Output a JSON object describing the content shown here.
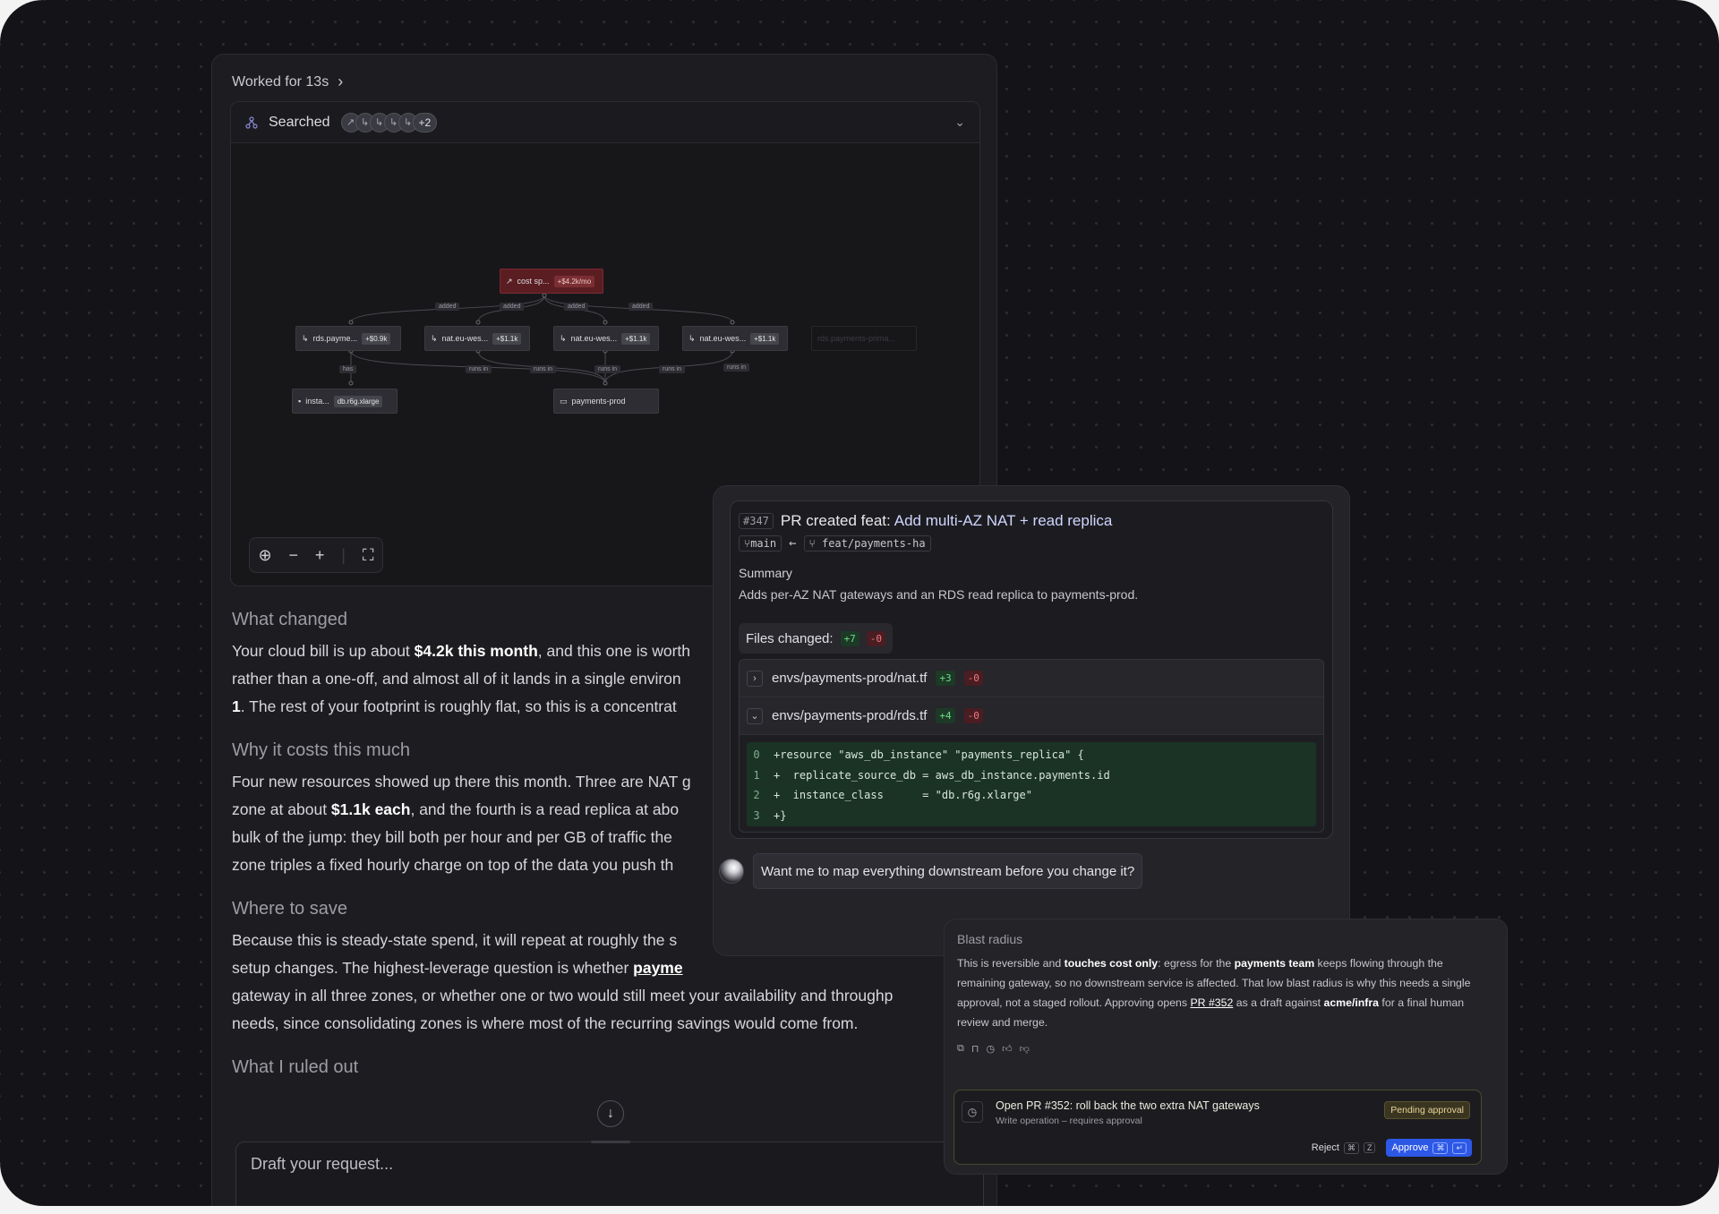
{
  "chat": {
    "worked_label": "Worked for 13s",
    "search_title": "Searched",
    "search_more": "+2",
    "graph": {
      "root": {
        "label": "cost sp...",
        "cost": "+$4.2k/mo"
      },
      "edge_added": "added",
      "edge_has": "has",
      "edge_runs_in": "runs in",
      "nodes": [
        {
          "label": "rds.payme...",
          "cost": "+$0.9k"
        },
        {
          "label": "nat.eu-wes...",
          "cost": "+$1.1k"
        },
        {
          "label": "nat.eu-wes...",
          "cost": "+$1.1k"
        },
        {
          "label": "nat.eu-wes...",
          "cost": "+$1.1k"
        },
        {
          "label": "rds.payments-prima..."
        }
      ],
      "instance": {
        "label": "insta...",
        "cost": "db.r6g.xlarge"
      },
      "env": {
        "label": "payments-prod"
      }
    },
    "sections": [
      {
        "heading": "What changed"
      },
      {
        "heading": "Why it costs this much"
      },
      {
        "heading": "Where to save"
      },
      {
        "heading": "What I ruled out"
      }
    ],
    "p1": {
      "a": "Your cloud bill is up about ",
      "b": "$4.2k this month",
      "c": ", and this one is worth",
      "d": "rather than a one-off, and almost all of it lands in a single environ",
      "e": "1",
      "f": ". The rest of your footprint is roughly flat, so this is a concentrat"
    },
    "p2": {
      "a": "Four new resources showed up there this month. Three are NAT g",
      "b": "zone at about ",
      "c": "$1.1k each",
      "d": ", and the fourth is a read replica at abo",
      "e": "bulk of the jump: they bill both per hour and per GB of traffic the",
      "f": "zone triples a fixed hourly charge on top of the data you push th"
    },
    "p3": {
      "a": "Because this is steady-state spend, it will repeat at roughly the s",
      "b": "setup changes. The highest-leverage question is whether ",
      "c": "payme",
      "d": "gateway in all three zones, or whether one or two would still meet your availability and throughp",
      "e": "needs, since consolidating zones is where most of the recurring savings would come from."
    },
    "draft_placeholder": "Draft your request..."
  },
  "pr": {
    "number": "#347",
    "title_prefix": "PR created feat: ",
    "title_main": "Add multi-AZ NAT + read replica",
    "base_branch": "main",
    "head_branch": "feat/payments-ha",
    "summary_label": "Summary",
    "summary_text": "Adds per-AZ NAT gateways and an RDS read replica to payments-prod.",
    "files_label": "Files changed:",
    "files_add": "+7",
    "files_del": "-0",
    "files": [
      {
        "name": "envs/payments-prod/nat.tf",
        "add": "+3",
        "del": "-0"
      },
      {
        "name": "envs/payments-prod/rds.tf",
        "add": "+4",
        "del": "-0"
      }
    ],
    "code": [
      {
        "n": "0",
        "t": "+resource \"aws_db_instance\" \"payments_replica\" {"
      },
      {
        "n": "1",
        "t": "+  replicate_source_db = aws_db_instance.payments.id"
      },
      {
        "n": "2",
        "t": "+  instance_class      = \"db.r6g.xlarge\""
      },
      {
        "n": "3",
        "t": "+}"
      }
    ],
    "question": "Want me to map everything downstream before you change it?"
  },
  "blast": {
    "heading": "Blast radius",
    "t1": "This is reversible and ",
    "t2": "touches cost only",
    "t3": ": egress for the ",
    "t4": "payments team",
    "t5": " keeps flowing through the remaining gateway, so no downstream service is affected. That low blast radius is why this needs a single approval, not a staged rollout. Approving opens ",
    "t6": "PR #352",
    "t7": " as a draft against ",
    "t8": "acme/infra",
    "t9": " for a final human review and merge.",
    "approval": {
      "title": "Open PR #352: roll back the two extra NAT gateways",
      "subtitle": "Write operation – requires approval",
      "status": "Pending approval",
      "reject_label": "Reject",
      "reject_keys": [
        "⌘",
        "Z"
      ],
      "approve_label": "Approve",
      "approve_keys": [
        "⌘",
        "↵"
      ]
    }
  }
}
